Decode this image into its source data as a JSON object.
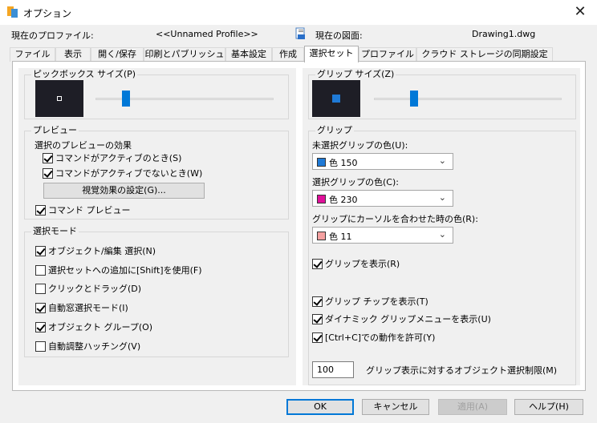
{
  "window": {
    "title": "オプション",
    "close_glyph": "✕"
  },
  "profile": {
    "current_profile_label": "現在のプロファイル:",
    "current_profile_value": "<<Unnamed Profile>>",
    "current_drawing_label": "現在の図面:",
    "current_drawing_value": "Drawing1.dwg"
  },
  "tabs": [
    {
      "label": "ファイル"
    },
    {
      "label": "表示"
    },
    {
      "label": "開く/保存"
    },
    {
      "label": "印刷とパブリッシュ"
    },
    {
      "label": "基本設定"
    },
    {
      "label": "作成"
    },
    {
      "label": "選択セット"
    },
    {
      "label": "プロファイル"
    },
    {
      "label": "クラウド ストレージの同期設定"
    }
  ],
  "pickbox": {
    "title": "ピックボックス サイズ(P)",
    "level": 0.3
  },
  "preview": {
    "title": "プレビュー",
    "effect_label": "選択のプレビューの効果",
    "active_label": "コマンドがアクティブのとき(S)",
    "inactive_label": "コマンドがアクティブでないとき(W)",
    "visual_button": "視覚効果の設定(G)...",
    "command_preview_label": "コマンド プレビュー"
  },
  "mode": {
    "title": "選択モード",
    "items": [
      {
        "label": "オブジェクト/編集 選択(N)",
        "checked": true
      },
      {
        "label": "選択セットへの追加に[Shift]を使用(F)",
        "checked": false
      },
      {
        "label": "クリックとドラッグ(D)",
        "checked": false
      },
      {
        "label": "自動窓選択モード(I)",
        "checked": true
      },
      {
        "label": "オブジェクト グループ(O)",
        "checked": true
      },
      {
        "label": "自動調整ハッチング(V)",
        "checked": false
      }
    ]
  },
  "grip_size": {
    "title": "グリップ サイズ(Z)",
    "level": 0.3
  },
  "grips": {
    "title": "グリップ",
    "unselected_label": "未選択グリップの色(U):",
    "unselected_value": "色 150",
    "unselected_color": "#1f7ad6",
    "selected_label": "選択グリップの色(C):",
    "selected_value": "色 230",
    "selected_color": "#e0109a",
    "hover_label": "グリップにカーソルを合わせた時の色(R):",
    "hover_value": "色 11",
    "hover_color": "#f4a0a0",
    "show_grips_label": "グリップを表示(R)",
    "show_tips_label": "グリップ チップを表示(T)",
    "dynamic_menu_label": "ダイナミック グリップメニューを表示(U)",
    "ctrl_cycle_label": "[Ctrl+C]での動作を許可(Y)",
    "limit_value": "100",
    "limit_label": "グリップ表示に対するオブジェクト選択制限(M)"
  },
  "footer": {
    "ok": "OK",
    "cancel": "キャンセル",
    "apply": "適用(A)",
    "help": "ヘルプ(H)"
  }
}
